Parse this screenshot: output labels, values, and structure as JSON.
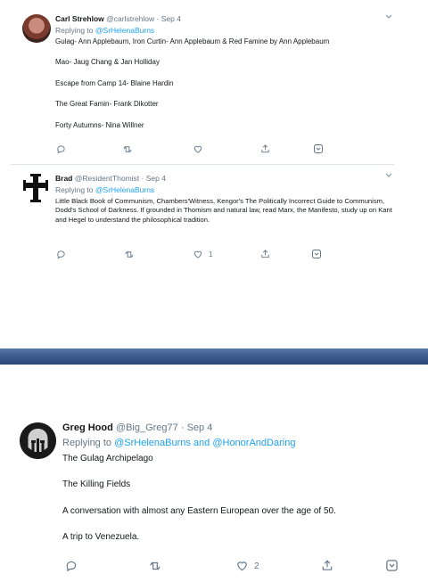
{
  "tweets": [
    {
      "name": "Carl Strehlow",
      "handle": "@carlstrehlow",
      "separator": "·",
      "date": "Sep 4",
      "reply_prefix": "Replying to",
      "reply_mentions": "@SrHelenaBurns",
      "lines": [
        "Gulag- Ann Applebaum, Iron Curtin- Ann Applebaum & Red Famine by Ann Applebaum",
        "Mao- Jaug Chang & Jan Holliday",
        "Escape from Camp 14- Blaine Hardin",
        "The Great Famin- Frank Dikotter",
        "Forty Autumns- Nina Willner"
      ],
      "likes": "",
      "avatar_icon": "profile-photo-icon"
    },
    {
      "name": "Brad",
      "handle": "@ResidentThomist",
      "separator": "·",
      "date": "Sep 4",
      "reply_prefix": "Replying to",
      "reply_mentions": "@SrHelenaBurns",
      "text": "Little Black Book of Communism, Chambers'Witness, Kengor's The Politically Incorrect Guide to Communism, Dodd's School of Darkness. If grounded in Thomism and natural law, read Marx, the Manifesto, study up on Kant and Hegel to understand the philosophical tradition.",
      "likes": "1",
      "avatar_icon": "cross-icon"
    },
    {
      "name": "Greg Hood",
      "handle": "@Big_Greg77",
      "separator": "·",
      "date": "Sep 4",
      "reply_prefix": "Replying to",
      "reply_mentions": "@SrHelenaBurns and @HonorAndDaring",
      "lines": [
        "The Gulag Archipelago",
        "The Killing Fields",
        "A conversation with almost any Eastern European over the age of 50.",
        "A trip to Venezuela."
      ],
      "likes": "2",
      "avatar_icon": "spartan-helmet-icon"
    }
  ],
  "colors": {
    "link": "#1da1f2",
    "muted": "#657786",
    "text": "#14171a",
    "band": "#3d5e8d"
  }
}
